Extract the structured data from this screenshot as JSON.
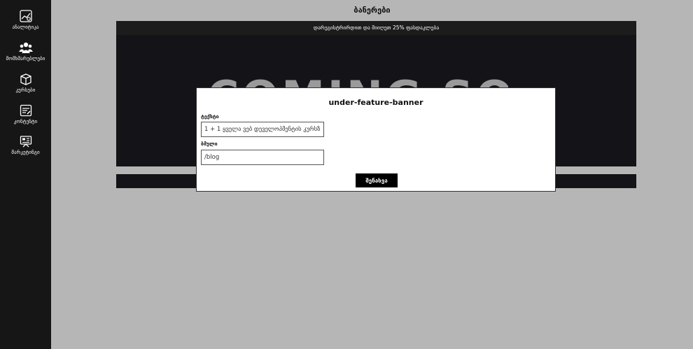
{
  "sidebar": {
    "items": [
      {
        "label": "ანალიტიკა",
        "icon": "analytics-icon"
      },
      {
        "label": "მომხმარებლები",
        "icon": "users-icon"
      },
      {
        "label": "კურსები",
        "icon": "courses-icon"
      },
      {
        "label": "კონტენტი",
        "icon": "content-icon"
      },
      {
        "label": "მარკეტინგი",
        "icon": "marketing-icon"
      }
    ]
  },
  "page": {
    "title": "ბანერები"
  },
  "banner": {
    "caption": "დარეგისტრირდით და მიიღეთ 25% ფასდაკლება",
    "art_text": "COMING SOON"
  },
  "modal": {
    "title": "under-feature-banner",
    "text_label": "ტექსტი",
    "text_value": "1 + 1 ყველა ვებ დეველოპმენტის კურსზე",
    "link_label": "ბმული",
    "link_value": "/blog",
    "save_label": "შენახვა"
  }
}
